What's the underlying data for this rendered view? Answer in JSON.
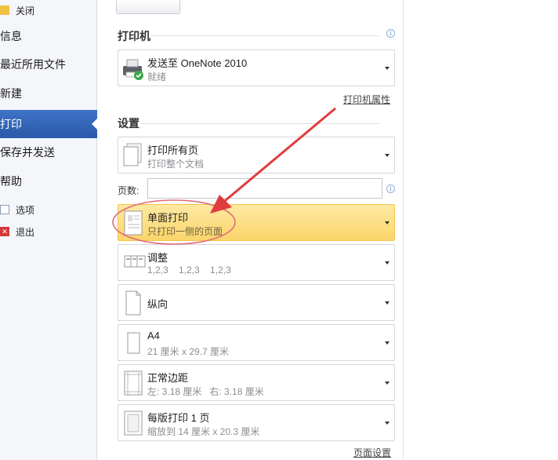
{
  "nav": {
    "close": "关闭",
    "info": "信息",
    "recent": "最近所用文件",
    "new": "新建",
    "print": "打印",
    "save_send": "保存并发送",
    "help": "帮助",
    "options": "选项",
    "exit": "退出"
  },
  "printer": {
    "heading": "打印机",
    "name": "发送至 OneNote 2010",
    "status": "就绪",
    "properties_link": "打印机属性",
    "icon": "printer-icon"
  },
  "settings": {
    "heading": "设置",
    "scope": {
      "title": "打印所有页",
      "subtitle": "打印整个文档"
    },
    "pages_label": "页数:",
    "pages_value": "",
    "sides": {
      "title": "单面打印",
      "subtitle": "只打印一侧的页面"
    },
    "collate": {
      "title": "调整",
      "subtitle": "1,2,3    1,2,3    1,2,3"
    },
    "orientation": {
      "title": "纵向"
    },
    "paper": {
      "title": "A4",
      "subtitle": "21 厘米 x 29.7 厘米"
    },
    "margins": {
      "title": "正常边距",
      "subtitle": "左: 3.18 厘米   右: 3.18 厘米"
    },
    "per_sheet": {
      "title": "每版打印 1 页",
      "subtitle": "缩放到 14 厘米 x 20.3 厘米"
    },
    "page_setup_link": "页面设置"
  },
  "colors": {
    "nav_active": "#2f62b3",
    "highlight": "#fbd56a",
    "annotation_red": "#e03c3c"
  }
}
